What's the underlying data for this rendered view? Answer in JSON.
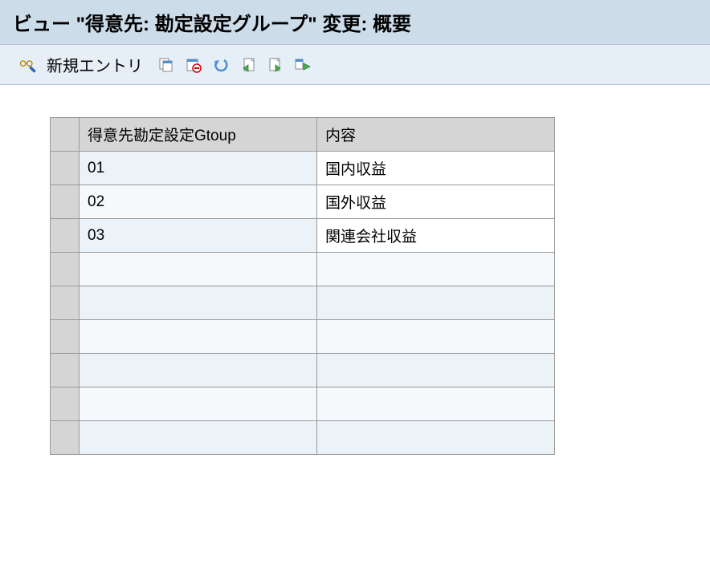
{
  "title": "ビュー \"得意先: 勘定設定グループ\" 変更: 概要",
  "toolbar": {
    "new_entry_label": "新規エントリ"
  },
  "table": {
    "columns": {
      "code": "得意先勘定設定Gtoup",
      "desc": "内容"
    },
    "rows": [
      {
        "code": "01",
        "desc": "国内収益"
      },
      {
        "code": "02",
        "desc": "国外収益"
      },
      {
        "code": "03",
        "desc": "関連会社収益"
      },
      {
        "code": "",
        "desc": ""
      },
      {
        "code": "",
        "desc": ""
      },
      {
        "code": "",
        "desc": ""
      },
      {
        "code": "",
        "desc": ""
      },
      {
        "code": "",
        "desc": ""
      },
      {
        "code": "",
        "desc": ""
      }
    ]
  }
}
